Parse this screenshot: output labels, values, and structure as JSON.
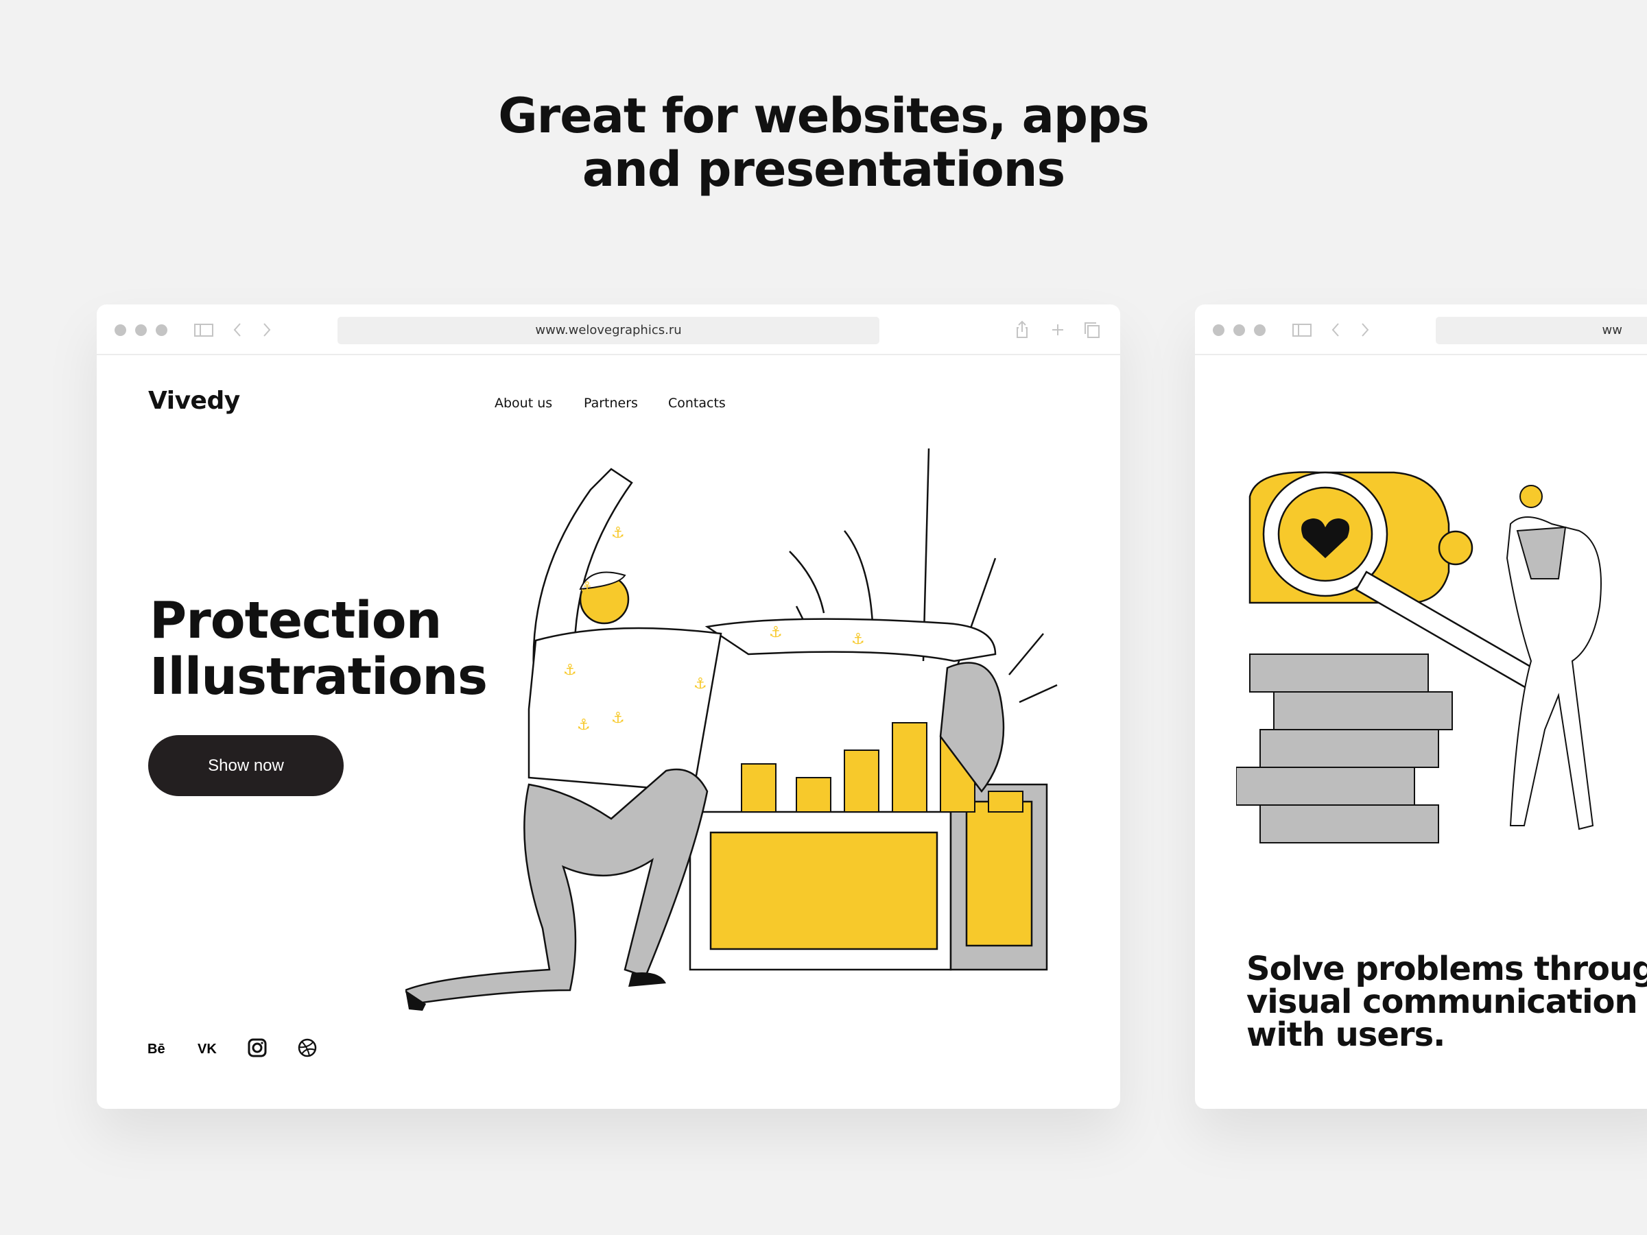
{
  "headline": {
    "line1": "Great for websites, apps",
    "line2": "and presentations"
  },
  "browser1": {
    "url": "www.welovegraphics.ru",
    "toolbar_icons": [
      "sidebar-icon",
      "back-icon",
      "forward-icon",
      "share-icon",
      "plus-icon",
      "tabs-icon"
    ],
    "site": {
      "logo": "Vivedy",
      "nav": [
        "About us",
        "Partners",
        "Contacts"
      ],
      "hero_line1": "Protection",
      "hero_line2": "Illustrations",
      "cta": "Show now",
      "social": [
        "behance-icon",
        "vk-icon",
        "instagram-icon",
        "dribbble-icon"
      ]
    }
  },
  "browser2": {
    "url": "ww",
    "text_line1": "Solve problems through",
    "text_line2": "visual communication",
    "text_line3": "with users."
  },
  "colors": {
    "accent": "#f7c92b",
    "gray": "#bdbdbd",
    "dark": "#231f20",
    "background": "#f2f2f2"
  }
}
